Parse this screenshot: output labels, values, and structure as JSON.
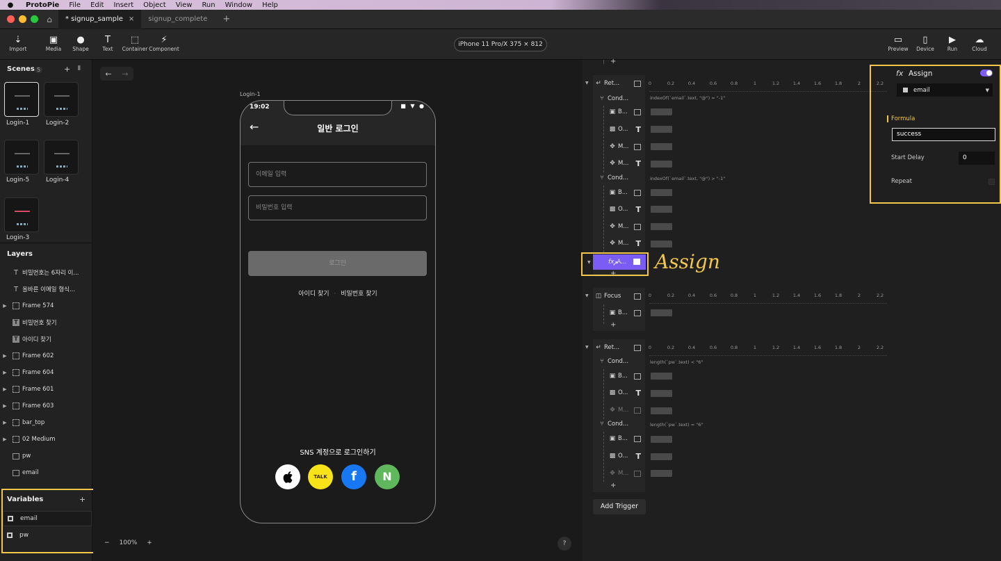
{
  "menubar": {
    "app": "ProtoPie",
    "items": [
      "File",
      "Edit",
      "Insert",
      "Object",
      "View",
      "Run",
      "Window",
      "Help"
    ]
  },
  "tabs": {
    "active": "* signup_sample",
    "inactive": "signup_complete",
    "close": "×",
    "add": "+"
  },
  "toolbar": {
    "import": "Import",
    "media": "Media",
    "shape": "Shape",
    "text": "Text",
    "container": "Container",
    "component": "Component",
    "device": "iPhone 11 Pro/X  375 × 812",
    "preview": "Preview",
    "device_btn": "Device",
    "run": "Run",
    "cloud": "Cloud"
  },
  "scenes": {
    "title": "Scenes",
    "count": "5",
    "add": "+",
    "items": [
      "Login-1",
      "Login-2",
      "Login-5",
      "Login-4",
      "Login-3"
    ]
  },
  "layers": {
    "title": "Layers",
    "items": [
      "비밀번호는 6자리 이...",
      "올바른 이메일 형식...",
      "Frame 574",
      "비밀번호 찾기",
      "아이디 찾기",
      "Frame 602",
      "Frame 604",
      "Frame 601",
      "Frame 603",
      "bar_top",
      "02 Medium",
      "pw",
      "email"
    ]
  },
  "variables": {
    "title": "Variables",
    "add": "+",
    "items": [
      "email",
      "pw"
    ]
  },
  "canvas": {
    "frame_label": "Login-1",
    "zoom": "100%",
    "zoom_minus": "−",
    "zoom_plus": "+",
    "help": "?"
  },
  "phone": {
    "time": "19:02",
    "status": "■ ▼ ●",
    "back": "←",
    "title": "일반 로그인",
    "email_placeholder": "이메일 입력",
    "pw_placeholder": "비밀번호 입력",
    "login": "로그인",
    "find_id": "아이디 찾기",
    "sep": "·",
    "find_pw": "비밀번호 찾기",
    "sns_title": "SNS 계정으로 로그인하기",
    "sns": {
      "apple": "",
      "kakao": "TALK",
      "facebook": "f",
      "naver": "N"
    }
  },
  "interactions": {
    "ticks": [
      "0",
      "0.2",
      "0.4",
      "0.6",
      "0.8",
      "1",
      "1.2",
      "1.4",
      "1.6",
      "1.8",
      "2",
      "2.2"
    ],
    "trigger1": "Ret...",
    "cond1": "Cond...",
    "cond1_expr": "indexOf(`email`.text, \"@\") = \"-1\"",
    "cond2": "Cond...",
    "cond2_expr": "indexOf(`email`.text, \"@\") > \"-1\"",
    "resp_b": "B...",
    "resp_o": "O...",
    "resp_m": "M...",
    "assign": "A...",
    "assign_note": "Assign",
    "trigger2": "Focus",
    "trigger3": "Ret...",
    "cond3": "Cond...",
    "cond3_expr": "length(`pw`.text) < \"6\"",
    "cond4": "Cond...",
    "cond4_expr": "length(`pw`.text) = \"6\"",
    "add": "+",
    "add_trigger": "Add Trigger"
  },
  "props": {
    "title": "Assign",
    "fx": "fx",
    "variable": "email",
    "formula_label": "Formula",
    "formula": "success",
    "start_delay_label": "Start Delay",
    "start_delay": "0",
    "repeat_label": "Repeat"
  },
  "colors": {
    "accent": "#7b5cf4",
    "highlight": "#f3c74a",
    "kakao": "#f7e317",
    "facebook": "#1877f2",
    "naver": "#5fb85b"
  }
}
